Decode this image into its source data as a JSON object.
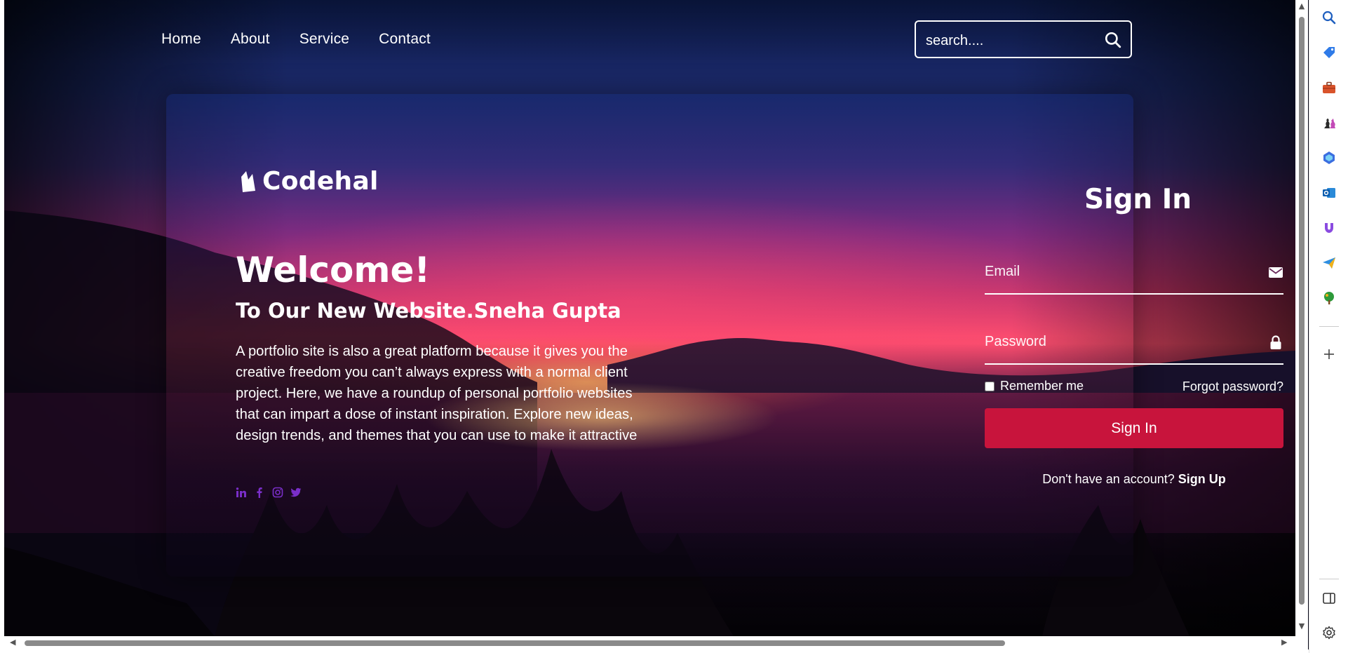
{
  "nav": {
    "items": [
      "Home",
      "About",
      "Service",
      "Contact"
    ]
  },
  "search": {
    "placeholder": "search...."
  },
  "brand": {
    "name": "Codehal"
  },
  "hero": {
    "heading": "Welcome!",
    "subheading": "To Our New Website.Sneha Gupta",
    "paragraph": "A portfolio site is also a great platform because it gives you the creative freedom you can’t always express with a normal client project. Here, we have a roundup of personal portfolio websites that can impart a dose of instant inspiration. Explore new ideas, design trends, and themes that you can use to make it attractive"
  },
  "social": {
    "icons": [
      "linkedin-icon",
      "facebook-icon",
      "instagram-icon",
      "twitter-icon"
    ],
    "color": "#7a2ec9"
  },
  "signin": {
    "title": "Sign In",
    "email_placeholder": "Email",
    "password_placeholder": "Password",
    "remember_label": "Remember me",
    "forgot_label": "Forgot password?",
    "button_label": "Sign In",
    "no_account_text": "Don't have an account?",
    "signup_link": "Sign Up"
  },
  "colors": {
    "accent": "#c8143c"
  },
  "browser_sidebar": {
    "icons": [
      "search-icon",
      "tag-icon",
      "briefcase-icon",
      "chess-icon",
      "copilot-icon",
      "outlook-icon",
      "magnet-icon",
      "send-icon",
      "tree-icon",
      "add-icon",
      "panel-icon",
      "settings-icon"
    ]
  }
}
